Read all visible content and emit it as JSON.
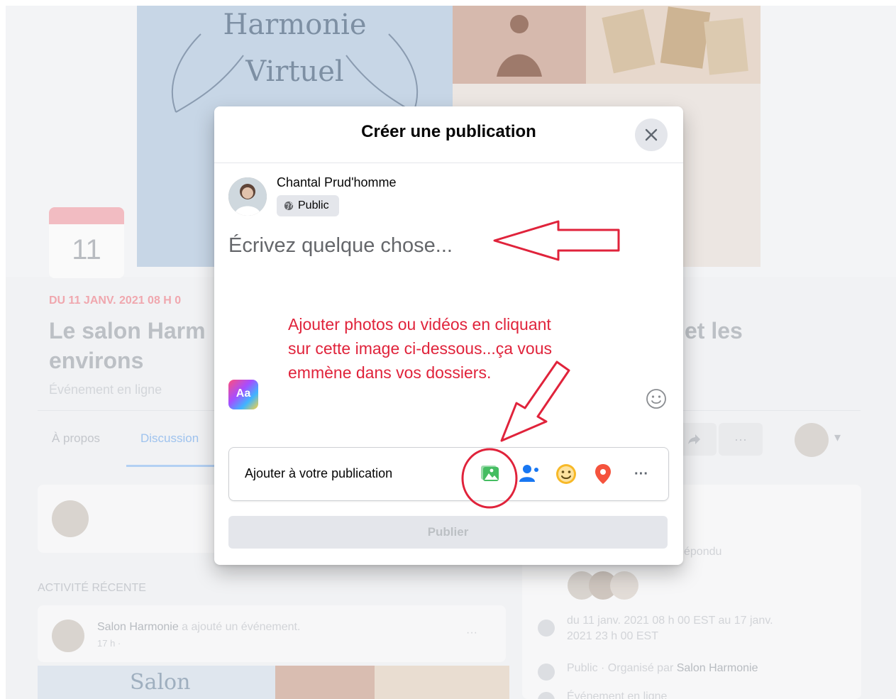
{
  "background": {
    "cover_text_line1": "Harmonie",
    "cover_text_line2": "Virtuel",
    "date_day": "11",
    "event_date": "DU 11 JANV. 2021 08 H 0",
    "event_title": "Le salon Harm",
    "event_title_line2": "environs",
    "event_title_right": "et les",
    "event_subtitle": "Événement en ligne",
    "tabs": [
      "À propos",
      "Discussion"
    ],
    "more_label": "···",
    "responded_text": "épondu",
    "recent_activity": "ACTIVITÉ RÉCENTE",
    "activity_author": "Salon Harmonie",
    "activity_action": " a ajouté un événement.",
    "activity_time": "17 h ·",
    "activity_more": "···",
    "detail_date": "du 11 janv. 2021 08 h 00 EST au 17 janv.",
    "detail_date2": "2021 23 h 00 EST",
    "detail_public": "Public · Organisé par ",
    "detail_org": "Salon Harmonie",
    "partial_text": "Événement en ligne",
    "thumb_text": "Salon"
  },
  "modal": {
    "title": "Créer une publication",
    "user_name": "Chantal Prud'homme",
    "privacy": "Public",
    "composer_placeholder": "Écrivez quelque chose...",
    "add_to_post": "Ajouter à votre publication",
    "publish": "Publier",
    "aa_label": "Aa",
    "more_label": "···"
  },
  "annotation": {
    "line1": "Ajouter photos ou vidéos en cliquant",
    "line2": "sur cette image ci-dessous...ça vous",
    "line3": "emmène dans vos dossiers."
  },
  "colors": {
    "annotation_red": "#e0233b",
    "photo_green": "#45bd62",
    "tag_blue": "#1877f2",
    "feeling_yellow": "#f7b928",
    "location_red": "#f5533d"
  }
}
